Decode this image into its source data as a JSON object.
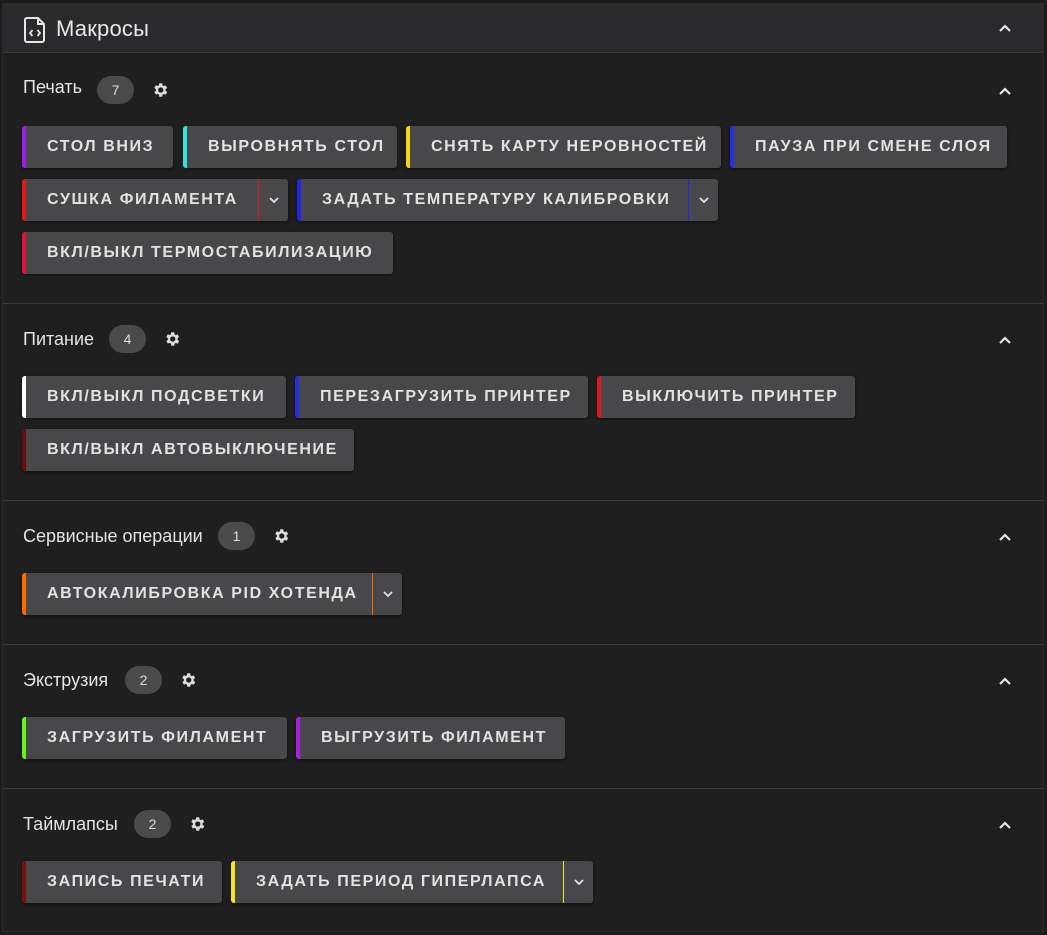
{
  "panel": {
    "title": "Макросы"
  },
  "sections": [
    {
      "title": "Печать",
      "count": "7",
      "buttons": [
        {
          "label": "СТОЛ ВНИЗ",
          "color": "#9b1fe8"
        },
        {
          "label": "ВЫРОВНЯТЬ СТОЛ",
          "color": "#2ee6d6"
        },
        {
          "label": "СНЯТЬ КАРТУ НЕРОВНОСТЕЙ",
          "color": "#f2d519"
        },
        {
          "label": "ПАУЗА ПРИ СМЕНЕ СЛОЯ",
          "color": "#2430e0"
        },
        {
          "label": "СУШКА ФИЛАМЕНТА",
          "color": "#e01616"
        },
        {
          "label": "ЗАДАТЬ ТЕМПЕРАТУРУ КАЛИБРОВКИ",
          "color": "#2222e8"
        },
        {
          "label": "ВКЛ/ВЫКЛ ТЕРМОСТАБИЛИЗАЦИЮ",
          "color": "#e0103c"
        }
      ]
    },
    {
      "title": "Питание",
      "count": "4",
      "buttons": [
        {
          "label": "ВКЛ/ВЫКЛ ПОДСВЕТКИ",
          "color": "#ffffff"
        },
        {
          "label": "ПЕРЕЗАГРУЗИТЬ ПРИНТЕР",
          "color": "#2430e0"
        },
        {
          "label": "ВЫКЛЮЧИТЬ ПРИНТЕР",
          "color": "#e01616"
        },
        {
          "label": "ВКЛ/ВЫКЛ АВТОВЫКЛЮЧЕНИЕ",
          "color": "#6b0c0c"
        }
      ]
    },
    {
      "title": "Сервисные операции",
      "count": "1",
      "buttons": [
        {
          "label": "АВТОКАЛИБРОВКА PID ХОТЕНДА",
          "color": "#ff6a00"
        }
      ]
    },
    {
      "title": "Экструзия",
      "count": "2",
      "buttons": [
        {
          "label": "ЗАГРУЗИТЬ ФИЛАМЕНТ",
          "color": "#66f21d"
        },
        {
          "label": "ВЫГРУЗИТЬ ФИЛАМЕНТ",
          "color": "#a722e0"
        }
      ]
    },
    {
      "title": "Таймлапсы",
      "count": "2",
      "buttons": [
        {
          "label": "ЗАПИСЬ ПЕЧАТИ",
          "color": "#7a0f0f"
        },
        {
          "label": "ЗАДАТЬ ПЕРИОД ГИПЕРЛАПСА",
          "color": "#f5e51c"
        }
      ]
    }
  ]
}
